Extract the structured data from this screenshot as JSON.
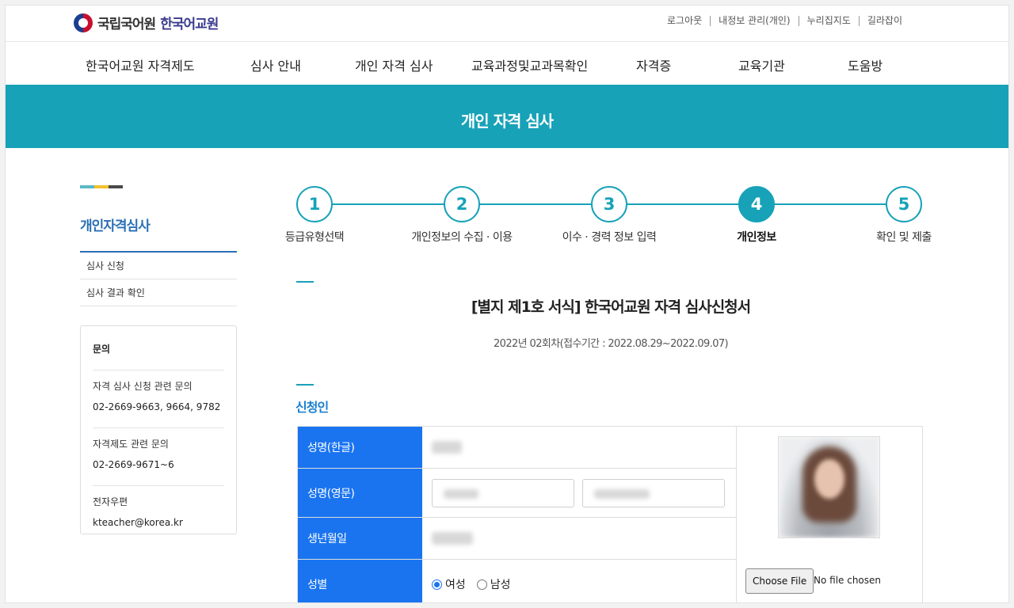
{
  "header": {
    "logo_primary": "국립국어원",
    "logo_secondary": "한국어교원",
    "util_links": [
      "로그아웃",
      "내정보 관리(개인)",
      "누리집지도",
      "길라잡이"
    ]
  },
  "gnb": [
    "한국어교원 자격제도",
    "심사 안내",
    "개인 자격 심사",
    "교육과정및교과목확인",
    "자격증",
    "교육기관",
    "도움방"
  ],
  "banner": {
    "title": "개인 자격 심사"
  },
  "sidebar": {
    "title": "개인자격심사",
    "menu": [
      "심사 신청",
      "심사 결과 확인"
    ],
    "contact": {
      "title": "문의",
      "sections": [
        {
          "label": "자격 심사 신청 관련 문의",
          "value": "02-2669-9663, 9664, 9782"
        },
        {
          "label": "자격제도 관련 문의",
          "value": "02-2669-9671~6"
        },
        {
          "label": "전자우편",
          "value": "kteacher@korea.kr"
        }
      ]
    }
  },
  "steps": [
    {
      "num": "1",
      "label": "등급유형선택",
      "active": false
    },
    {
      "num": "2",
      "label": "개인정보의 수집 · 이용",
      "active": false
    },
    {
      "num": "3",
      "label": "이수 · 경력 정보 입력",
      "active": false
    },
    {
      "num": "4",
      "label": "개인정보",
      "active": true
    },
    {
      "num": "5",
      "label": "확인 및 제출",
      "active": false
    }
  ],
  "form": {
    "title": "[별지 제1호 서식] 한국어교원 자격 심사신청서",
    "subtitle": "2022년 02회차(접수기간 : 2022.08.29~2022.09.07)",
    "section_title": "신청인",
    "rows": {
      "name_kr": "성명(한글)",
      "name_en": "성명(영문)",
      "birth": "생년월일",
      "gender": "성별"
    },
    "gender_options": [
      "여성",
      "남성"
    ],
    "gender_selected": "여성",
    "file_button": "Choose File",
    "file_status": "No file chosen"
  },
  "colors": {
    "accent": "#17a2b8",
    "table_header": "#1a74f0",
    "side_title": "#2a6fb5"
  }
}
